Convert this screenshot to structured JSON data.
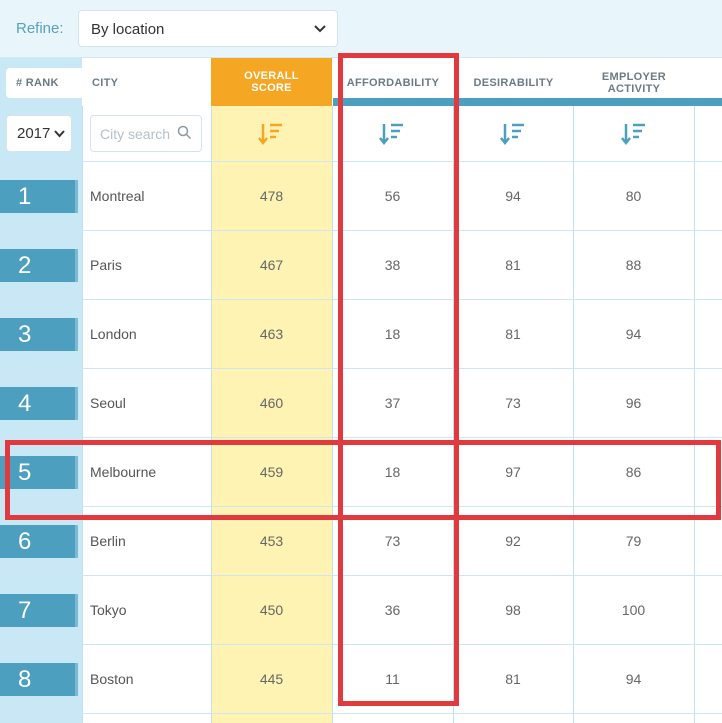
{
  "refine": {
    "label": "Refine:",
    "selected": "By location"
  },
  "header": {
    "rank": "# RANK",
    "city": "CITY",
    "overall": "OVERALL SCORE",
    "affordability": "AFFORDABILITY",
    "desirability": "DESIRABILITY",
    "employer_activity": "EMPLOYER ACTIVITY"
  },
  "filters": {
    "year": "2017",
    "city_search_placeholder": "City search"
  },
  "rows": [
    {
      "rank": "1",
      "city": "Montreal",
      "overall": "478",
      "affordability": "56",
      "desirability": "94",
      "employer": "80"
    },
    {
      "rank": "2",
      "city": "Paris",
      "overall": "467",
      "affordability": "38",
      "desirability": "81",
      "employer": "88"
    },
    {
      "rank": "3",
      "city": "London",
      "overall": "463",
      "affordability": "18",
      "desirability": "81",
      "employer": "94"
    },
    {
      "rank": "4",
      "city": "Seoul",
      "overall": "460",
      "affordability": "37",
      "desirability": "73",
      "employer": "96"
    },
    {
      "rank": "5",
      "city": "Melbourne",
      "overall": "459",
      "affordability": "18",
      "desirability": "97",
      "employer": "86"
    },
    {
      "rank": "6",
      "city": "Berlin",
      "overall": "453",
      "affordability": "73",
      "desirability": "92",
      "employer": "79"
    },
    {
      "rank": "7",
      "city": "Tokyo",
      "overall": "450",
      "affordability": "36",
      "desirability": "98",
      "employer": "100"
    },
    {
      "rank": "8",
      "city": "Boston",
      "overall": "445",
      "affordability": "11",
      "desirability": "81",
      "employer": "94"
    }
  ],
  "colors": {
    "accent_blue": "#4c9fbe",
    "overall_orange": "#f5a623",
    "highlight_red": "#e03a3e"
  },
  "icons": {
    "sort": "sort-descending-icon",
    "search": "search-icon",
    "chevron": "chevron-down-icon"
  }
}
